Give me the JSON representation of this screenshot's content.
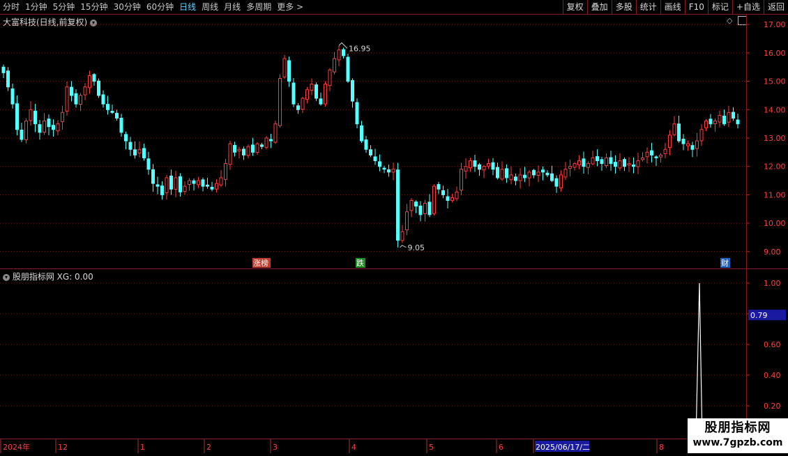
{
  "toolbar": {
    "periods": [
      "分时",
      "1分钟",
      "5分钟",
      "15分钟",
      "30分钟",
      "60分钟",
      "日线",
      "周线",
      "月线",
      "多周期",
      "更多 >"
    ],
    "active_period": "日线",
    "tools": [
      "复权",
      "叠加",
      "多股",
      "统计",
      "画线",
      "F10",
      "标记",
      "+自选",
      "返回"
    ]
  },
  "main_panel": {
    "title": "大富科技(日线,前复权)",
    "price_axis": [
      "17.00",
      "16.00",
      "15.00",
      "14.00",
      "13.00",
      "12.00",
      "11.00",
      "10.00",
      "9.00"
    ],
    "high_marker": "16.95",
    "low_marker": "9.05",
    "event_badges": [
      {
        "label": "涨榜",
        "color": "#c0392b"
      },
      {
        "label": "跌",
        "color": "#1e8c1e"
      },
      {
        "label": "财",
        "color": "#2060c0"
      }
    ]
  },
  "indicator_panel": {
    "title": "股朋指标网",
    "value_text": "XG: 0.00",
    "axis": [
      "1.00",
      "0.80",
      "0.60",
      "0.40",
      "0.20"
    ],
    "cursor_value": "0.79"
  },
  "date_axis": {
    "labels": [
      "2024年",
      "12",
      "1",
      "2",
      "3",
      "4",
      "5",
      "6",
      "2025/06/17/二",
      "8"
    ],
    "highlight": "2025/06/17/二"
  },
  "watermark": {
    "line1": "股朋指标网",
    "line2": "www.7gpzb.com"
  },
  "colors": {
    "up": "#ff3c3c",
    "down": "#54ffff",
    "grid": "#7a1a1a",
    "axis_text": "#ff4040"
  },
  "chart_data": {
    "type": "candlestick",
    "ylim": [
      8.7,
      17.2
    ],
    "close": [
      15.3,
      14.8,
      14.2,
      13.3,
      12.95,
      13.6,
      14.0,
      13.5,
      13.2,
      13.6,
      13.4,
      13.3,
      13.5,
      13.9,
      14.8,
      14.5,
      14.2,
      14.5,
      14.8,
      15.2,
      15.0,
      14.5,
      14.2,
      14.0,
      13.9,
      13.7,
      13.2,
      12.9,
      12.6,
      12.4,
      12.6,
      12.3,
      11.9,
      11.4,
      11.3,
      11.0,
      11.6,
      11.2,
      11.6,
      11.1,
      11.3,
      11.5,
      11.4,
      11.5,
      11.3,
      11.3,
      11.2,
      11.4,
      11.6,
      12.1,
      12.8,
      12.5,
      12.6,
      12.4,
      12.7,
      12.5,
      12.8,
      12.7,
      13.0,
      12.9,
      13.5,
      15.1,
      15.8,
      15.0,
      14.2,
      14.0,
      14.4,
      14.7,
      14.9,
      14.4,
      14.2,
      14.9,
      15.4,
      15.8,
      16.1,
      15.9,
      15.0,
      14.3,
      13.5,
      12.9,
      12.6,
      12.4,
      12.2,
      12.0,
      11.9,
      11.8,
      11.9,
      9.4,
      9.7,
      10.4,
      10.8,
      10.6,
      10.3,
      10.7,
      10.3,
      11.3,
      11.2,
      11.0,
      10.8,
      10.9,
      11.1,
      11.9,
      12.0,
      12.2,
      12.0,
      11.9,
      12.0,
      12.1,
      11.9,
      11.6,
      11.9,
      11.6,
      11.7,
      11.5,
      11.7,
      11.6,
      11.8,
      11.7,
      11.8,
      11.8,
      11.7,
      11.5,
      11.3,
      11.7,
      11.9,
      12.0,
      12.1,
      12.2,
      12.0,
      12.1,
      12.3,
      12.2,
      12.1,
      12.3,
      12.1,
      12.0,
      12.2,
      12.0,
      12.1,
      12.0,
      12.2,
      12.3,
      12.5,
      12.4,
      12.3,
      12.4,
      12.6,
      13.1,
      13.5,
      12.9,
      12.8,
      12.8,
      12.6,
      12.9,
      13.3,
      13.6,
      13.5,
      13.6,
      13.8,
      13.5,
      13.9,
      13.7,
      13.5
    ],
    "indicator_xg": {
      "peak_value": 1.0,
      "peak_position": "second-to-last bars"
    }
  }
}
